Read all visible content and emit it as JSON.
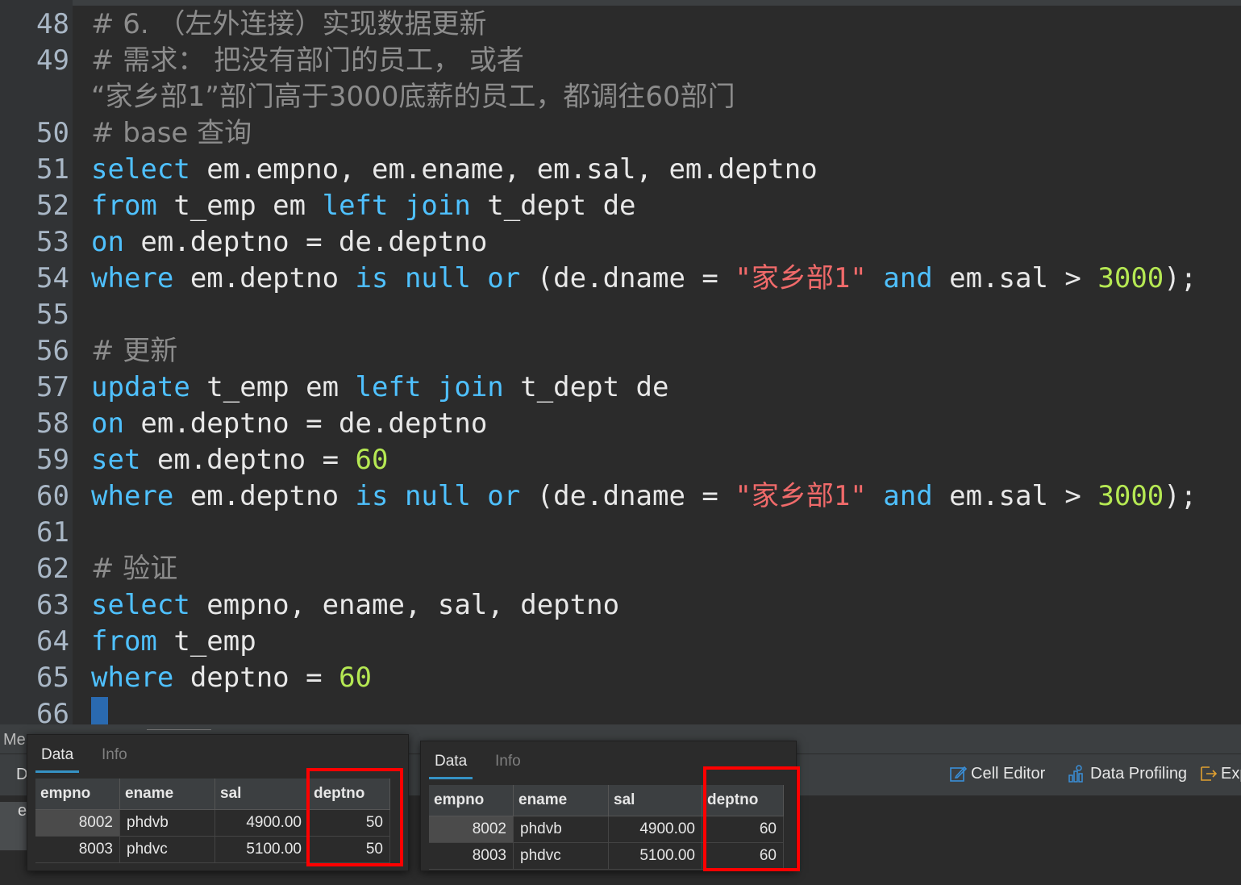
{
  "editor": {
    "lines": [
      {
        "n": "48",
        "tokens": [
          {
            "t": "# 6. （左外连接）实现数据更新",
            "c": "cmt"
          }
        ]
      },
      {
        "n": "49",
        "tokens": [
          {
            "t": "# 需求： 把没有部门的员工， 或者",
            "c": "cmt"
          }
        ]
      },
      {
        "n": "",
        "tokens": [
          {
            "t": "“家乡部1”部门高于3000底薪的员工，都调往60部门",
            "c": "cmt"
          }
        ]
      },
      {
        "n": "50",
        "tokens": [
          {
            "t": "# base 查询",
            "c": "cmt"
          }
        ]
      },
      {
        "n": "51",
        "tokens": [
          {
            "t": "select",
            "c": "kw"
          },
          {
            "t": " em.empno, em.ename, em.sal, em.deptno",
            "c": ""
          }
        ]
      },
      {
        "n": "52",
        "tokens": [
          {
            "t": "from",
            "c": "kw"
          },
          {
            "t": " t_emp em ",
            "c": ""
          },
          {
            "t": "left join",
            "c": "kw"
          },
          {
            "t": " t_dept de",
            "c": ""
          }
        ]
      },
      {
        "n": "53",
        "tokens": [
          {
            "t": "on",
            "c": "kw"
          },
          {
            "t": " em.deptno = de.deptno",
            "c": ""
          }
        ]
      },
      {
        "n": "54",
        "tokens": [
          {
            "t": "where",
            "c": "kw"
          },
          {
            "t": " em.deptno ",
            "c": ""
          },
          {
            "t": "is null or",
            "c": "kw"
          },
          {
            "t": " (de.dname = ",
            "c": ""
          },
          {
            "t": "\"家乡部1\"",
            "c": "str"
          },
          {
            "t": " ",
            "c": ""
          },
          {
            "t": "and",
            "c": "kw"
          },
          {
            "t": " em.sal > ",
            "c": ""
          },
          {
            "t": "3000",
            "c": "num"
          },
          {
            "t": ");",
            "c": ""
          }
        ]
      },
      {
        "n": "55",
        "tokens": []
      },
      {
        "n": "56",
        "tokens": [
          {
            "t": "# 更新",
            "c": "cmt"
          }
        ]
      },
      {
        "n": "57",
        "tokens": [
          {
            "t": "update",
            "c": "kw"
          },
          {
            "t": " t_emp em ",
            "c": ""
          },
          {
            "t": "left join",
            "c": "kw"
          },
          {
            "t": " t_dept de",
            "c": ""
          }
        ]
      },
      {
        "n": "58",
        "tokens": [
          {
            "t": "on",
            "c": "kw"
          },
          {
            "t": " em.deptno = de.deptno",
            "c": ""
          }
        ]
      },
      {
        "n": "59",
        "tokens": [
          {
            "t": "set",
            "c": "kw"
          },
          {
            "t": " em.deptno = ",
            "c": ""
          },
          {
            "t": "60",
            "c": "num"
          }
        ]
      },
      {
        "n": "60",
        "tokens": [
          {
            "t": "where",
            "c": "kw"
          },
          {
            "t": " em.deptno ",
            "c": ""
          },
          {
            "t": "is null or",
            "c": "kw"
          },
          {
            "t": " (de.dname = ",
            "c": ""
          },
          {
            "t": "\"家乡部1\"",
            "c": "str"
          },
          {
            "t": " ",
            "c": ""
          },
          {
            "t": "and",
            "c": "kw"
          },
          {
            "t": " em.sal > ",
            "c": ""
          },
          {
            "t": "3000",
            "c": "num"
          },
          {
            "t": ");",
            "c": ""
          }
        ]
      },
      {
        "n": "61",
        "tokens": []
      },
      {
        "n": "62",
        "tokens": [
          {
            "t": "# 验证",
            "c": "cmt"
          }
        ]
      },
      {
        "n": "63",
        "tokens": [
          {
            "t": "select",
            "c": "kw"
          },
          {
            "t": " empno, ename, sal, deptno",
            "c": ""
          }
        ]
      },
      {
        "n": "64",
        "tokens": [
          {
            "t": "from",
            "c": "kw"
          },
          {
            "t": " t_emp",
            "c": ""
          }
        ]
      },
      {
        "n": "65",
        "tokens": [
          {
            "t": "where",
            "c": "kw"
          },
          {
            "t": " deptno = ",
            "c": ""
          },
          {
            "t": "60",
            "c": "num"
          }
        ]
      },
      {
        "n": "66",
        "tokens": []
      }
    ]
  },
  "bottom": {
    "messages_tab": "Me",
    "data_tab_short": "D",
    "grid_label_short": "e",
    "cell_editor_label": "Cell Editor",
    "data_profiling_label": "Data Profiling",
    "export_label": "Exp"
  },
  "panel_before": {
    "tab_data": "Data",
    "tab_info": "Info",
    "columns": [
      "empno",
      "ename",
      "sal",
      "deptno"
    ],
    "rows": [
      [
        "8002",
        "phdvb",
        "4900.00",
        "50"
      ],
      [
        "8003",
        "phdvc",
        "5100.00",
        "50"
      ]
    ]
  },
  "panel_after": {
    "tab_data": "Data",
    "tab_info": "Info",
    "columns": [
      "empno",
      "ename",
      "sal",
      "deptno"
    ],
    "rows": [
      [
        "8002",
        "phdvb",
        "4900.00",
        "60"
      ],
      [
        "8003",
        "phdvc",
        "5100.00",
        "60"
      ]
    ]
  },
  "colors": {
    "keyword": "#4fc1ff",
    "number": "#b5e853",
    "string": "#f06a6a",
    "comment": "#8c8c8c",
    "highlight_box": "#ff0000"
  }
}
